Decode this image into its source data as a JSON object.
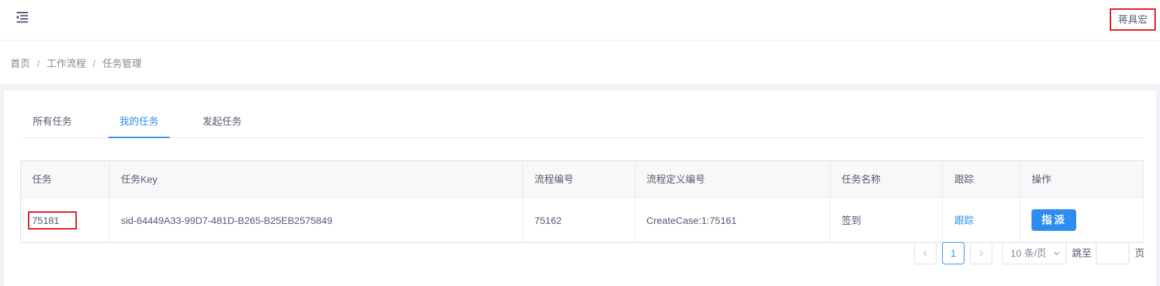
{
  "header": {
    "menu_icon": "menu-fold-icon",
    "user_name": "蒋具宏"
  },
  "breadcrumb": {
    "items": [
      "首页",
      "工作流程",
      "任务管理"
    ],
    "separator": "/"
  },
  "tabs": [
    {
      "label": "所有任务",
      "active": false
    },
    {
      "label": "我的任务",
      "active": true
    },
    {
      "label": "发起任务",
      "active": false
    }
  ],
  "table": {
    "columns": [
      "任务",
      "任务Key",
      "流程编号",
      "流程定义编号",
      "任务名称",
      "跟踪",
      "操作"
    ],
    "rows": [
      {
        "task": "75181",
        "task_key": "sid-64449A33-99D7-481D-B265-B25EB2575849",
        "process_id": "75162",
        "process_def_id": "CreateCase:1:75161",
        "task_name": "签到",
        "track": "跟踪",
        "action": "指派"
      }
    ]
  },
  "pagination": {
    "prev_icon": "chevron-left-icon",
    "current_page": "1",
    "next_icon": "chevron-right-icon",
    "page_size": "10 条/页",
    "jump_label": "跳至",
    "jump_value": "",
    "page_label": "页"
  },
  "colors": {
    "accent": "#2d8cf0",
    "highlight_box": "#e0101a"
  }
}
